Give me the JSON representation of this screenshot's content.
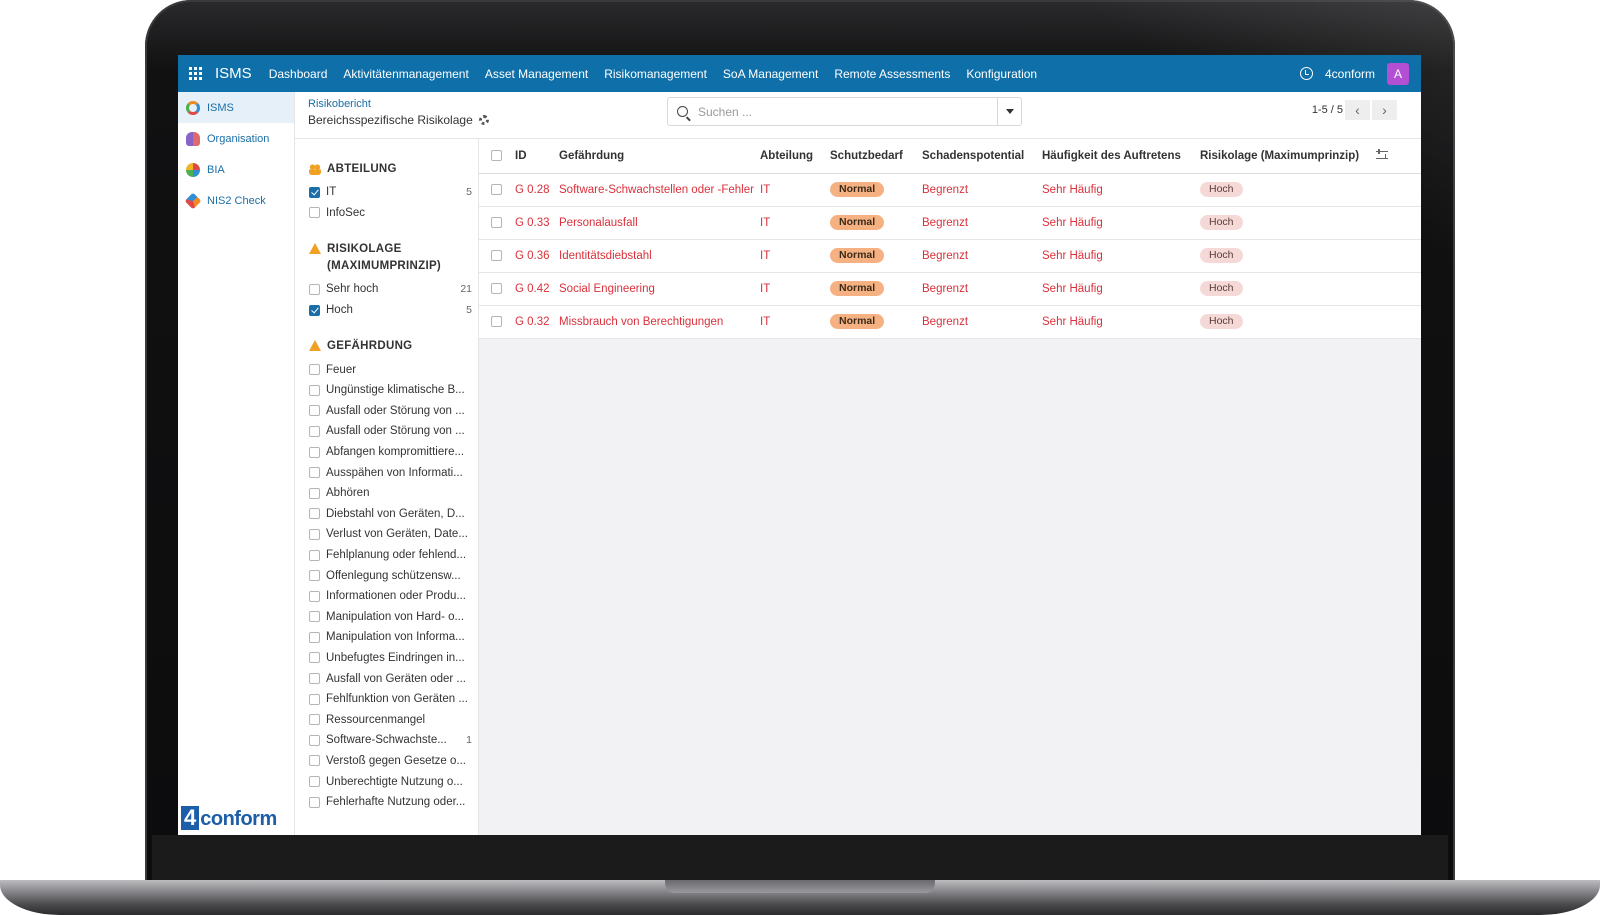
{
  "topnav": {
    "app_title": "ISMS",
    "items": [
      "Dashboard",
      "Aktivitätenmanagement",
      "Asset Management",
      "Risikomanagement",
      "SoA Management",
      "Remote Assessments",
      "Konfiguration"
    ],
    "company": "4conform",
    "avatar_letter": "A",
    "avatar_color": "#b34fd3",
    "bar_color": "#0f6fa8"
  },
  "app_sidebar": {
    "items": [
      {
        "label": "ISMS",
        "icon": "isms-icon",
        "active": true
      },
      {
        "label": "Organisation",
        "icon": "organisation-icon"
      },
      {
        "label": "BIA",
        "icon": "bia-icon"
      },
      {
        "label": "NIS2 Check",
        "icon": "nis2-icon"
      }
    ],
    "brand_four": "4",
    "brand_word": "conform"
  },
  "control": {
    "breadcrumb_parent": "Risikobericht",
    "breadcrumb_current": "Bereichsspezifische Risikolage",
    "search_placeholder": "Suchen ...",
    "pager": "1-5 / 5"
  },
  "filters": {
    "groups": [
      {
        "title": "ABTEILUNG",
        "icon": "people-icon",
        "items": [
          {
            "label": "IT",
            "checked": true,
            "count": "5"
          },
          {
            "label": "InfoSec",
            "checked": false,
            "count": ""
          }
        ]
      },
      {
        "title": "RISIKOLAGE (MAXIMUMPRINZIP)",
        "icon": "warning-icon",
        "items": [
          {
            "label": "Sehr hoch",
            "checked": false,
            "count": "21"
          },
          {
            "label": "Hoch",
            "checked": true,
            "count": "5"
          }
        ]
      },
      {
        "title": "GEFÄHRDUNG",
        "icon": "warning-icon",
        "items": [
          {
            "label": "Feuer",
            "checked": false,
            "count": ""
          },
          {
            "label": "Ungünstige klimatische B...",
            "checked": false,
            "count": ""
          },
          {
            "label": "Ausfall oder Störung von ...",
            "checked": false,
            "count": ""
          },
          {
            "label": "Ausfall oder Störung von ...",
            "checked": false,
            "count": ""
          },
          {
            "label": "Abfangen kompromittiere...",
            "checked": false,
            "count": ""
          },
          {
            "label": "Ausspähen von Informati...",
            "checked": false,
            "count": ""
          },
          {
            "label": "Abhören",
            "checked": false,
            "count": ""
          },
          {
            "label": "Diebstahl von Geräten, D...",
            "checked": false,
            "count": ""
          },
          {
            "label": "Verlust von Geräten, Date...",
            "checked": false,
            "count": ""
          },
          {
            "label": "Fehlplanung oder fehlend...",
            "checked": false,
            "count": ""
          },
          {
            "label": "Offenlegung schützensw...",
            "checked": false,
            "count": ""
          },
          {
            "label": "Informationen oder Produ...",
            "checked": false,
            "count": ""
          },
          {
            "label": "Manipulation von Hard- o...",
            "checked": false,
            "count": ""
          },
          {
            "label": "Manipulation von Informa...",
            "checked": false,
            "count": ""
          },
          {
            "label": "Unbefugtes Eindringen in...",
            "checked": false,
            "count": ""
          },
          {
            "label": "Ausfall von Geräten oder ...",
            "checked": false,
            "count": ""
          },
          {
            "label": "Fehlfunktion von Geräten ...",
            "checked": false,
            "count": ""
          },
          {
            "label": "Ressourcenmangel",
            "checked": false,
            "count": ""
          },
          {
            "label": "Software-Schwachste...",
            "checked": false,
            "count": "1"
          },
          {
            "label": "Verstoß gegen Gesetze o...",
            "checked": false,
            "count": ""
          },
          {
            "label": "Unberechtigte Nutzung o...",
            "checked": false,
            "count": ""
          },
          {
            "label": "Fehlerhafte Nutzung oder...",
            "checked": false,
            "count": ""
          }
        ]
      }
    ]
  },
  "table": {
    "columns": [
      "ID",
      "Gefährdung",
      "Abteilung",
      "Schutzbedarf",
      "Schadenspotential",
      "Häufigkeit des Auftretens",
      "Risikolage (Maximumprinzip)"
    ],
    "rows": [
      {
        "id": "G 0.28",
        "gefaehrdung": "Software-Schwachstellen oder -Fehler",
        "abteilung": "IT",
        "schutzbedarf": "Normal",
        "schaden": "Begrenzt",
        "haeufigkeit": "Sehr Häufig",
        "risiko": "Hoch"
      },
      {
        "id": "G 0.33",
        "gefaehrdung": "Personalausfall",
        "abteilung": "IT",
        "schutzbedarf": "Normal",
        "schaden": "Begrenzt",
        "haeufigkeit": "Sehr Häufig",
        "risiko": "Hoch"
      },
      {
        "id": "G 0.36",
        "gefaehrdung": "Identitätsdiebstahl",
        "abteilung": "IT",
        "schutzbedarf": "Normal",
        "schaden": "Begrenzt",
        "haeufigkeit": "Sehr Häufig",
        "risiko": "Hoch"
      },
      {
        "id": "G 0.42",
        "gefaehrdung": "Social Engineering",
        "abteilung": "IT",
        "schutzbedarf": "Normal",
        "schaden": "Begrenzt",
        "haeufigkeit": "Sehr Häufig",
        "risiko": "Hoch"
      },
      {
        "id": "G 0.32",
        "gefaehrdung": "Missbrauch von Berechtigungen",
        "abteilung": "IT",
        "schutzbedarf": "Normal",
        "schaden": "Begrenzt",
        "haeufigkeit": "Sehr Häufig",
        "risiko": "Hoch"
      }
    ],
    "row_text_color": "#d9313b"
  }
}
